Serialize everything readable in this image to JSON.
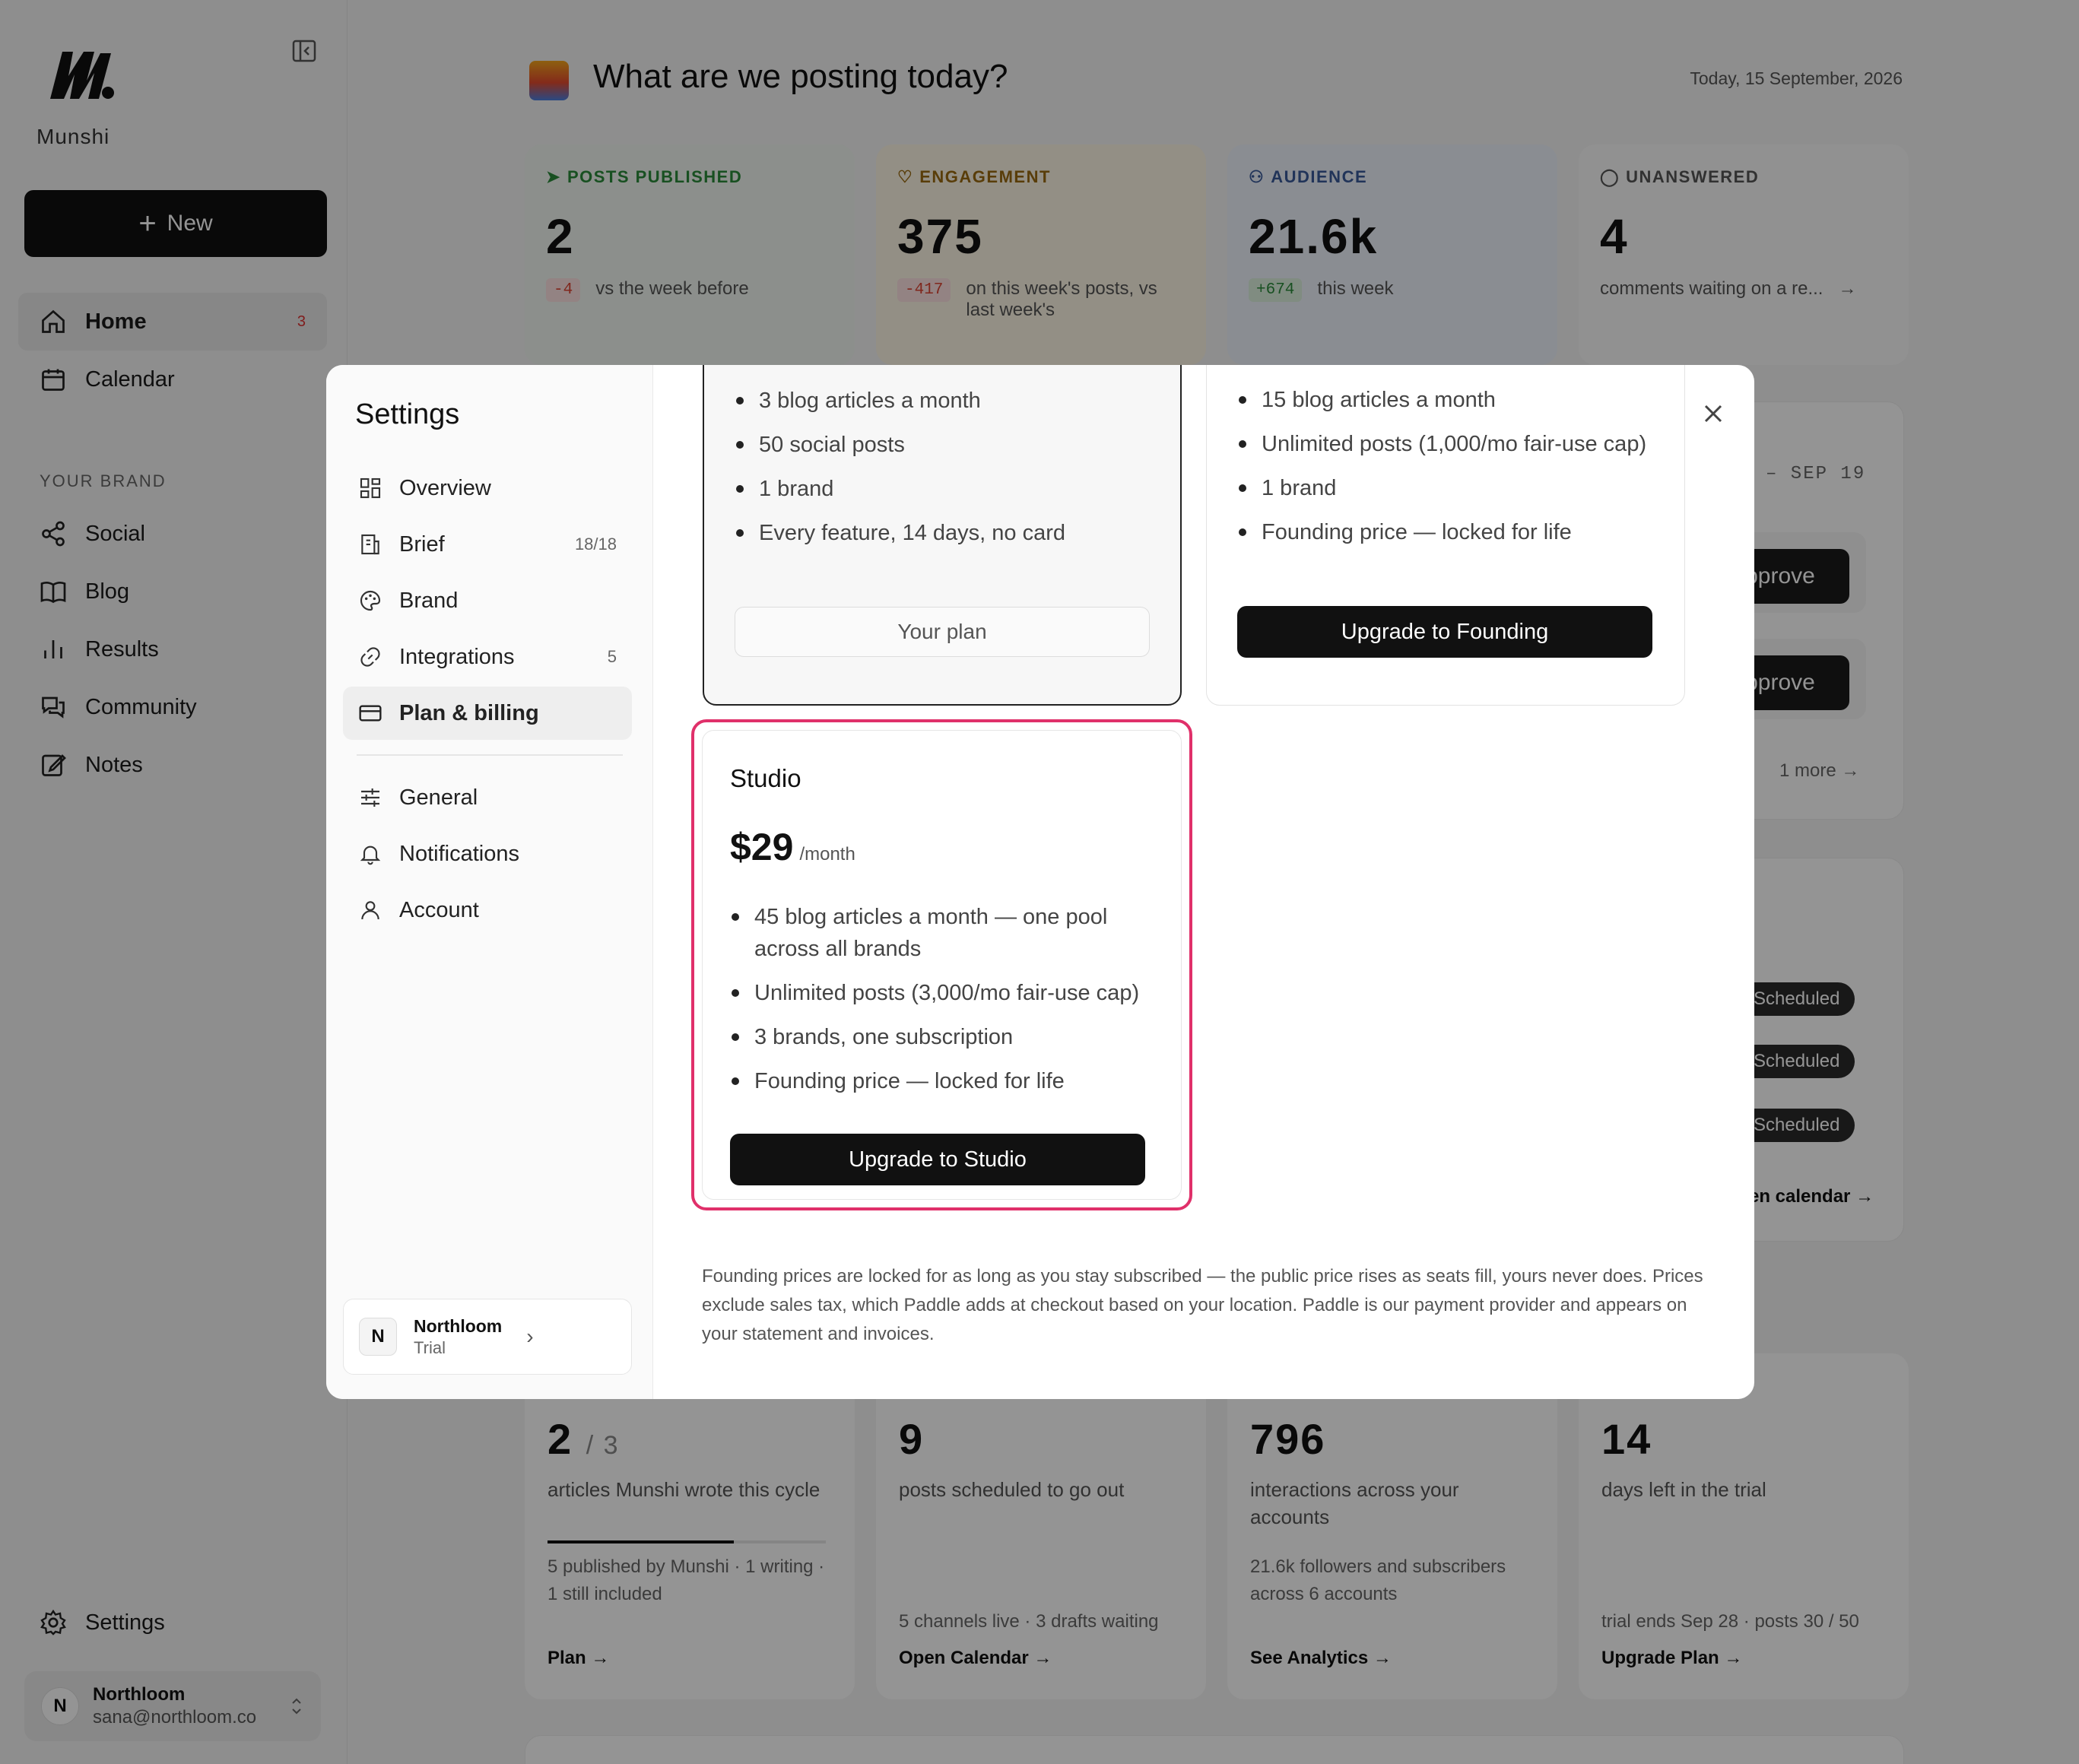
{
  "sidebar": {
    "brand": "Munshi",
    "new_label": "New",
    "nav": [
      {
        "label": "Home",
        "badge": "3"
      },
      {
        "label": "Calendar"
      }
    ],
    "section_label": "YOUR BRAND",
    "brand_nav": [
      {
        "label": "Social"
      },
      {
        "label": "Blog"
      },
      {
        "label": "Results"
      },
      {
        "label": "Community"
      },
      {
        "label": "Notes"
      }
    ],
    "settings_label": "Settings",
    "user": {
      "initial": "N",
      "name": "Northloom",
      "email": "sana@northloom.co"
    }
  },
  "header": {
    "title": "What are we posting today?",
    "date": "Today, 15 September, 2026"
  },
  "stats": [
    {
      "label": "POSTS PUBLISHED",
      "value": "2",
      "chip": "-4",
      "text": "vs the week before"
    },
    {
      "label": "ENGAGEMENT",
      "value": "375",
      "chip": "-417",
      "text": "on this week's posts, vs last week's"
    },
    {
      "label": "AUDIENCE",
      "value": "21.6k",
      "chip": "+674",
      "text": "this week"
    },
    {
      "label": "UNANSWERED",
      "value": "4",
      "text": "comments waiting on a re..."
    }
  ],
  "background": {
    "date_range": "– SEP 19",
    "approve": "pprove",
    "more": "1 more",
    "scheduled": "Scheduled",
    "calendar_link": "en calendar →"
  },
  "bottom_stats": [
    {
      "value": "2",
      "total": "/ 3",
      "desc": "articles Munshi wrote this cycle",
      "foot": "5 published by Munshi · 1 writing · 1 still included",
      "link": "Plan →",
      "progress": 0.67
    },
    {
      "value": "9",
      "desc": "posts scheduled to go out",
      "foot": "5 channels live · 3 drafts waiting",
      "link": "Open Calendar →"
    },
    {
      "value": "796",
      "desc": "interactions across your accounts",
      "foot": "21.6k followers and subscribers across 6 accounts",
      "link": "See Analytics →"
    },
    {
      "value": "14",
      "desc": "days left in the trial",
      "foot": "trial ends Sep 28 · posts 30 / 50",
      "link": "Upgrade Plan →"
    }
  ],
  "settings": {
    "title": "Settings",
    "menu": [
      {
        "label": "Overview"
      },
      {
        "label": "Brief",
        "count": "18/18"
      },
      {
        "label": "Brand"
      },
      {
        "label": "Integrations",
        "count": "5"
      },
      {
        "label": "Plan & billing"
      },
      {
        "label": "General"
      },
      {
        "label": "Notifications"
      },
      {
        "label": "Account"
      }
    ],
    "org": {
      "initial": "N",
      "name": "Northloom",
      "status": "Trial"
    }
  },
  "plans": {
    "trial": {
      "features": [
        "3 blog articles a month",
        "50 social posts",
        "1 brand",
        "Every feature, 14 days, no card"
      ],
      "button": "Your plan"
    },
    "founding": {
      "features": [
        "15 blog articles a month",
        "Unlimited posts (1,000/mo fair-use cap)",
        "1 brand",
        "Founding price — locked for life"
      ],
      "button": "Upgrade to Founding"
    },
    "studio": {
      "name": "Studio",
      "price": "$29",
      "period": "/month",
      "features": [
        "45 blog articles a month — one pool across all brands",
        "Unlimited posts (3,000/mo fair-use cap)",
        "3 brands, one subscription",
        "Founding price — locked for life"
      ],
      "button": "Upgrade to Studio"
    },
    "footnote": "Founding prices are locked for as long as you stay subscribed — the public price rises as seats fill, yours never does. Prices exclude sales tax, which Paddle adds at checkout based on your location. Paddle is our payment provider and appears on your statement and invoices."
  },
  "colors": {
    "highlight": "#e0306a",
    "accent_dark": "#111111"
  }
}
